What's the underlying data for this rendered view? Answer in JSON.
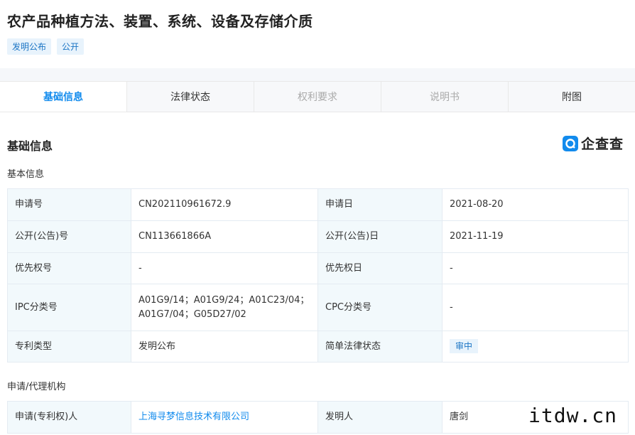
{
  "header": {
    "title": "农产品种植方法、装置、系统、设备及存储介质",
    "tags": [
      "发明公布",
      "公开"
    ]
  },
  "tabs": [
    {
      "label": "基础信息",
      "state": "active"
    },
    {
      "label": "法律状态",
      "state": "normal"
    },
    {
      "label": "权利要求",
      "state": "disabled"
    },
    {
      "label": "说明书",
      "state": "disabled"
    },
    {
      "label": "附图",
      "state": "normal"
    }
  ],
  "section": {
    "title": "基础信息",
    "logo_text": "企查查",
    "logo_icon": "qichacha-logo-icon"
  },
  "basic_info": {
    "title": "基本信息",
    "rows": [
      [
        "申请号",
        "CN202110961672.9",
        "申请日",
        "2021-08-20"
      ],
      [
        "公开(公告)号",
        "CN113661866A",
        "公开(公告)日",
        "2021-11-19"
      ],
      [
        "优先权号",
        "-",
        "优先权日",
        "-"
      ],
      [
        "IPC分类号",
        "A01G9/14；A01G9/24；A01C23/04；A01G7/04；G05D27/02",
        "CPC分类号",
        "-"
      ],
      [
        "专利类型",
        "发明公布",
        "简单法律状态",
        "审中"
      ]
    ]
  },
  "agency": {
    "title": "申请/代理机构",
    "rows": [
      [
        "申请(专利权)人",
        "上海寻梦信息技术有限公司",
        "发明人",
        "唐剑"
      ]
    ]
  },
  "watermark": "itdw.cn",
  "colors": {
    "accent": "#128bed",
    "label_bg": "#f2f9fc",
    "tag_bg": "#e8f3fc"
  }
}
